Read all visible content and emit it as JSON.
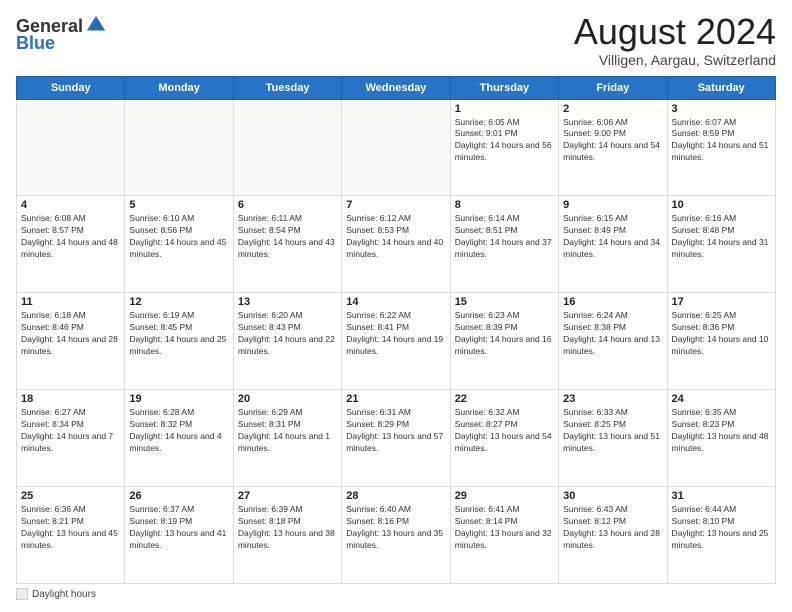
{
  "header": {
    "logo_general": "General",
    "logo_blue": "Blue",
    "month_title": "August 2024",
    "location": "Villigen, Aargau, Switzerland"
  },
  "weekdays": [
    "Sunday",
    "Monday",
    "Tuesday",
    "Wednesday",
    "Thursday",
    "Friday",
    "Saturday"
  ],
  "weeks": [
    [
      {
        "day": "",
        "info": ""
      },
      {
        "day": "",
        "info": ""
      },
      {
        "day": "",
        "info": ""
      },
      {
        "day": "",
        "info": ""
      },
      {
        "day": "1",
        "info": "Sunrise: 6:05 AM\nSunset: 9:01 PM\nDaylight: 14 hours and 56 minutes."
      },
      {
        "day": "2",
        "info": "Sunrise: 6:06 AM\nSunset: 9:00 PM\nDaylight: 14 hours and 54 minutes."
      },
      {
        "day": "3",
        "info": "Sunrise: 6:07 AM\nSunset: 8:59 PM\nDaylight: 14 hours and 51 minutes."
      }
    ],
    [
      {
        "day": "4",
        "info": "Sunrise: 6:08 AM\nSunset: 8:57 PM\nDaylight: 14 hours and 48 minutes."
      },
      {
        "day": "5",
        "info": "Sunrise: 6:10 AM\nSunset: 8:56 PM\nDaylight: 14 hours and 45 minutes."
      },
      {
        "day": "6",
        "info": "Sunrise: 6:11 AM\nSunset: 8:54 PM\nDaylight: 14 hours and 43 minutes."
      },
      {
        "day": "7",
        "info": "Sunrise: 6:12 AM\nSunset: 8:53 PM\nDaylight: 14 hours and 40 minutes."
      },
      {
        "day": "8",
        "info": "Sunrise: 6:14 AM\nSunset: 8:51 PM\nDaylight: 14 hours and 37 minutes."
      },
      {
        "day": "9",
        "info": "Sunrise: 6:15 AM\nSunset: 8:49 PM\nDaylight: 14 hours and 34 minutes."
      },
      {
        "day": "10",
        "info": "Sunrise: 6:16 AM\nSunset: 8:48 PM\nDaylight: 14 hours and 31 minutes."
      }
    ],
    [
      {
        "day": "11",
        "info": "Sunrise: 6:18 AM\nSunset: 8:46 PM\nDaylight: 14 hours and 28 minutes."
      },
      {
        "day": "12",
        "info": "Sunrise: 6:19 AM\nSunset: 8:45 PM\nDaylight: 14 hours and 25 minutes."
      },
      {
        "day": "13",
        "info": "Sunrise: 6:20 AM\nSunset: 8:43 PM\nDaylight: 14 hours and 22 minutes."
      },
      {
        "day": "14",
        "info": "Sunrise: 6:22 AM\nSunset: 8:41 PM\nDaylight: 14 hours and 19 minutes."
      },
      {
        "day": "15",
        "info": "Sunrise: 6:23 AM\nSunset: 8:39 PM\nDaylight: 14 hours and 16 minutes."
      },
      {
        "day": "16",
        "info": "Sunrise: 6:24 AM\nSunset: 8:38 PM\nDaylight: 14 hours and 13 minutes."
      },
      {
        "day": "17",
        "info": "Sunrise: 6:25 AM\nSunset: 8:36 PM\nDaylight: 14 hours and 10 minutes."
      }
    ],
    [
      {
        "day": "18",
        "info": "Sunrise: 6:27 AM\nSunset: 8:34 PM\nDaylight: 14 hours and 7 minutes."
      },
      {
        "day": "19",
        "info": "Sunrise: 6:28 AM\nSunset: 8:32 PM\nDaylight: 14 hours and 4 minutes."
      },
      {
        "day": "20",
        "info": "Sunrise: 6:29 AM\nSunset: 8:31 PM\nDaylight: 14 hours and 1 minutes."
      },
      {
        "day": "21",
        "info": "Sunrise: 6:31 AM\nSunset: 8:29 PM\nDaylight: 13 hours and 57 minutes."
      },
      {
        "day": "22",
        "info": "Sunrise: 6:32 AM\nSunset: 8:27 PM\nDaylight: 13 hours and 54 minutes."
      },
      {
        "day": "23",
        "info": "Sunrise: 6:33 AM\nSunset: 8:25 PM\nDaylight: 13 hours and 51 minutes."
      },
      {
        "day": "24",
        "info": "Sunrise: 6:35 AM\nSunset: 8:23 PM\nDaylight: 13 hours and 48 minutes."
      }
    ],
    [
      {
        "day": "25",
        "info": "Sunrise: 6:36 AM\nSunset: 8:21 PM\nDaylight: 13 hours and 45 minutes."
      },
      {
        "day": "26",
        "info": "Sunrise: 6:37 AM\nSunset: 8:19 PM\nDaylight: 13 hours and 41 minutes."
      },
      {
        "day": "27",
        "info": "Sunrise: 6:39 AM\nSunset: 8:18 PM\nDaylight: 13 hours and 38 minutes."
      },
      {
        "day": "28",
        "info": "Sunrise: 6:40 AM\nSunset: 8:16 PM\nDaylight: 13 hours and 35 minutes."
      },
      {
        "day": "29",
        "info": "Sunrise: 6:41 AM\nSunset: 8:14 PM\nDaylight: 13 hours and 32 minutes."
      },
      {
        "day": "30",
        "info": "Sunrise: 6:43 AM\nSunset: 8:12 PM\nDaylight: 13 hours and 28 minutes."
      },
      {
        "day": "31",
        "info": "Sunrise: 6:44 AM\nSunset: 8:10 PM\nDaylight: 13 hours and 25 minutes."
      }
    ]
  ],
  "footer": {
    "daylight_label": "Daylight hours"
  }
}
